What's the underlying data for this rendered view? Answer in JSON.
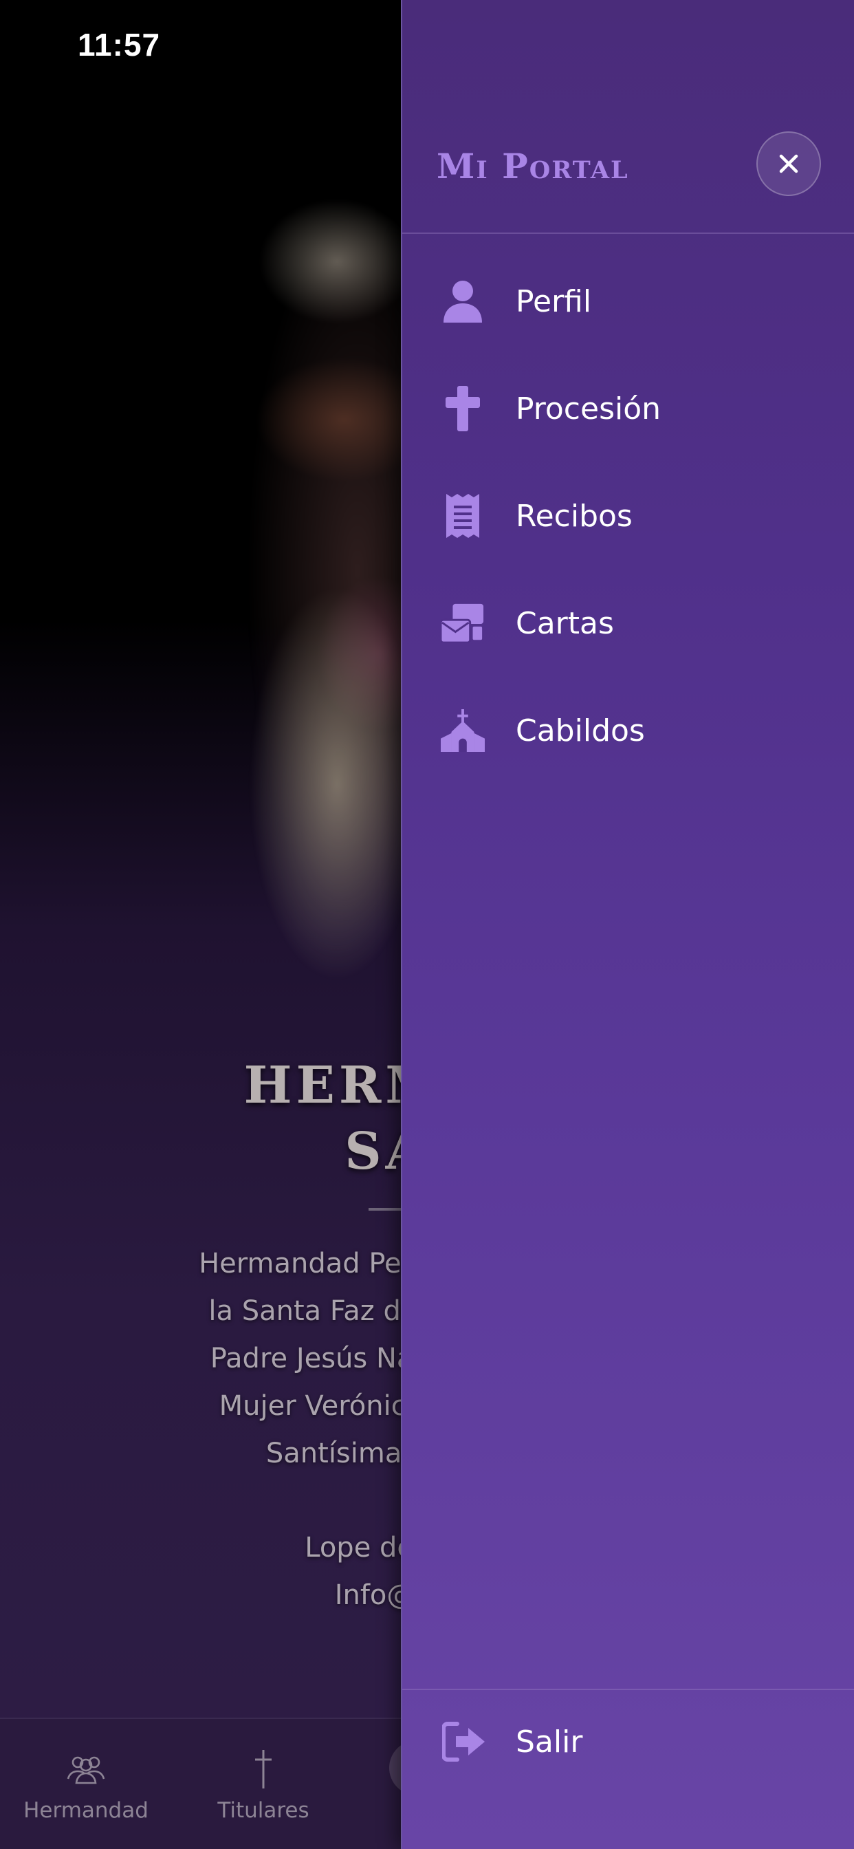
{
  "status_bar": {
    "time": "11:57"
  },
  "background_page": {
    "title_lines": [
      "HERMAN",
      "SANT"
    ],
    "description_lines": [
      "Hermandad Penitencial y",
      "la Santa Faz de Nuestro",
      "Padre Jesús Nazareno e",
      "Mujer Verónica, Nues",
      "Santísima de la Tr"
    ],
    "address_lines": [
      "Lope de Hoces",
      "Info@santa"
    ]
  },
  "tab_bar": {
    "tabs": [
      {
        "label": "Hermandad",
        "icon": "people-icon"
      },
      {
        "label": "Titulares",
        "icon": "cross-icon"
      }
    ]
  },
  "drawer": {
    "title": "Mi Portal",
    "close_icon": "close-icon",
    "accent_color": "#a985e6",
    "items": [
      {
        "label": "Perfil",
        "icon": "user-icon"
      },
      {
        "label": "Procesión",
        "icon": "cross-icon"
      },
      {
        "label": "Recibos",
        "icon": "receipt-icon"
      },
      {
        "label": "Cartas",
        "icon": "mail-icon"
      },
      {
        "label": "Cabildos",
        "icon": "church-icon"
      }
    ],
    "logout": {
      "label": "Salir",
      "icon": "logout-icon"
    }
  }
}
